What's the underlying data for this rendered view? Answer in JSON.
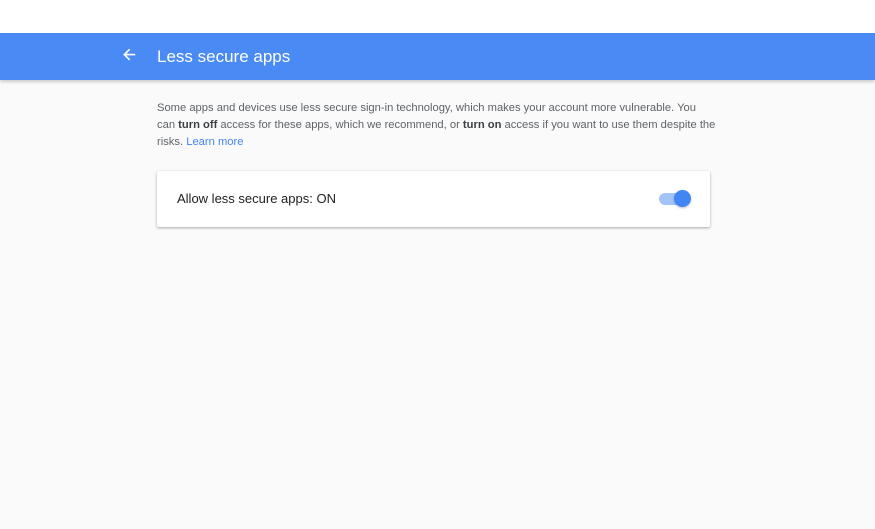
{
  "header": {
    "back_icon": "arrow-left-icon",
    "title": "Less secure apps",
    "color": "#4a8af4"
  },
  "description": {
    "part1": "Some apps and devices use less secure sign-in technology, which makes your account more vulnerable. You can ",
    "turn_off": "turn off",
    "part2": " access for these apps, which we recommend, or ",
    "turn_on": "turn on",
    "part3": " access if you want to use them despite the risks. ",
    "learn_more": "Learn more"
  },
  "setting": {
    "label": "Allow less secure apps: ON",
    "toggle_state": "on",
    "accent": "#4285f4"
  }
}
